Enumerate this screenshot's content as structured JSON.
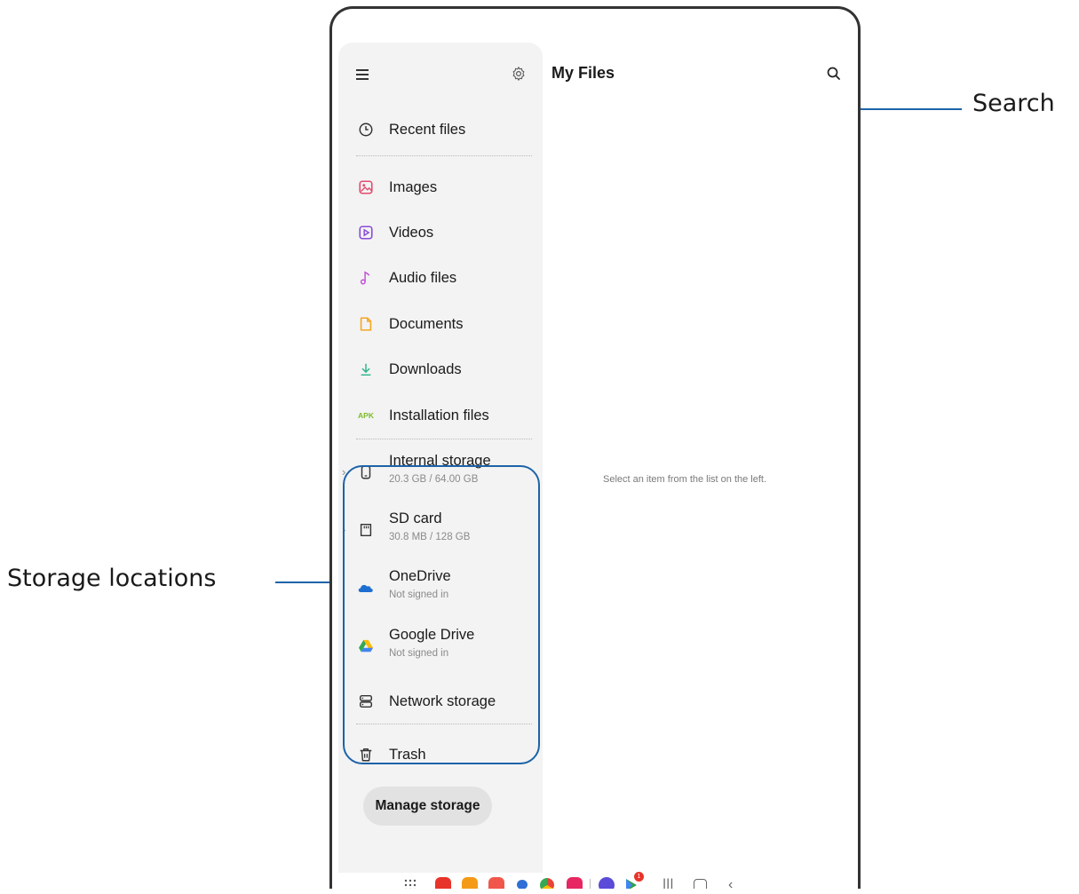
{
  "callouts": {
    "search": "Search",
    "storage": "Storage locations"
  },
  "header": {
    "title": "My Files",
    "menu_icon": "hamburger-icon",
    "settings_icon": "gear-icon",
    "search_icon": "search-icon"
  },
  "drawer": {
    "recent": {
      "label": "Recent files",
      "icon": "clock-icon"
    },
    "categories": [
      {
        "label": "Images",
        "icon": "image-icon",
        "color": "#e34b6f"
      },
      {
        "label": "Videos",
        "icon": "video-icon",
        "color": "#8a4bd8"
      },
      {
        "label": "Audio files",
        "icon": "music-note-icon",
        "color": "#c24fd6"
      },
      {
        "label": "Documents",
        "icon": "document-icon",
        "color": "#f5a623"
      },
      {
        "label": "Downloads",
        "icon": "download-icon",
        "color": "#2bb48a"
      },
      {
        "label": "Installation files",
        "icon": "apk-icon",
        "badge": "APK",
        "color": "#7dbb2b"
      }
    ],
    "storage": [
      {
        "label": "Internal storage",
        "sub": "20.3 GB / 64.00 GB",
        "icon": "phone-icon"
      },
      {
        "label": "SD card",
        "sub": "30.8 MB / 128 GB",
        "icon": "sd-card-icon"
      },
      {
        "label": "OneDrive",
        "sub": "Not signed in",
        "icon": "onedrive-icon",
        "color": "#1c6fd1"
      },
      {
        "label": "Google Drive",
        "sub": "Not signed in",
        "icon": "google-drive-icon"
      },
      {
        "label": "Network storage",
        "icon": "network-storage-icon"
      }
    ],
    "trash": {
      "label": "Trash",
      "icon": "trash-icon"
    },
    "manage_button": "Manage storage"
  },
  "main": {
    "empty_message": "Select an item from the list on the left."
  },
  "navbar": {
    "apps": [
      {
        "name": "app-drawer-icon"
      },
      {
        "name": "app-icon-red",
        "color": "#e8332a"
      },
      {
        "name": "app-icon-orange",
        "color": "#f59a16"
      },
      {
        "name": "contacts-app-icon",
        "color": "#f0574a"
      },
      {
        "name": "messages-app-icon",
        "color": "#2f6fd6"
      },
      {
        "name": "chrome-app-icon",
        "color": "#2f9e48"
      },
      {
        "name": "camera-app-icon",
        "color": "#e62763"
      },
      {
        "name": "internet-app-icon",
        "color": "#5b4bd8"
      },
      {
        "name": "play-store-app-icon",
        "color": "#2f9e48",
        "badge": "1"
      }
    ],
    "recents_icon": "recents-icon",
    "home_icon": "home-icon",
    "back_icon": "back-icon"
  }
}
